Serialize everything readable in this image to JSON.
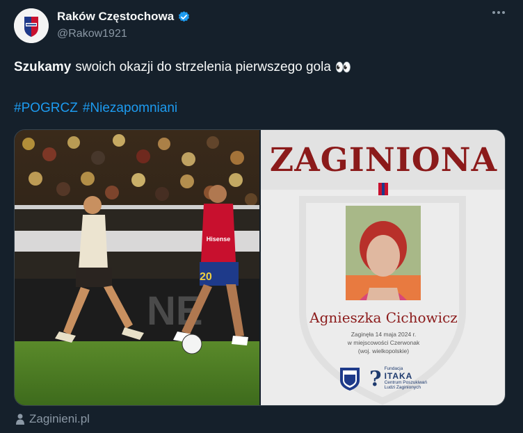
{
  "author": {
    "display_name": "Raków Częstochowa",
    "handle": "@Rakow1921",
    "avatar_icon": "club-crest-icon",
    "verified_icon": "verified-badge-icon"
  },
  "menu": {
    "icon": "more-options-icon"
  },
  "tweet": {
    "bold_text": "Szukamy",
    "text": "swoich okazji do strzelenia pierwszego gola",
    "emoji": "👀",
    "hashtags": [
      "#POGRCZ",
      "#Niezapomniani"
    ]
  },
  "media": {
    "photo": {
      "player_number": "20",
      "sponsor": "Hisense"
    },
    "poster": {
      "title": "ZAGINIONA",
      "person_name": "Agnieszka Cichowicz",
      "detail_lines": [
        "Zaginęła 14 maja 2024 r.",
        "w miejscowości Czerwonak",
        "(woj. wielkopolskie)"
      ],
      "partner": {
        "small_top": "Fundacja",
        "name": "ITAKA",
        "small_bottom_1": "Centrum Poszukiwań",
        "small_bottom_2": "Ludzi Zaginionych"
      }
    }
  },
  "source_link": {
    "text": "Zaginieni.pl",
    "icon": "person-icon"
  },
  "colors": {
    "background": "#15202b",
    "link": "#1d9bf0",
    "secondary_text": "#8b98a5",
    "poster_title": "#8b1a1a",
    "club_red": "#c8102e",
    "club_blue": "#1e3a8a"
  }
}
